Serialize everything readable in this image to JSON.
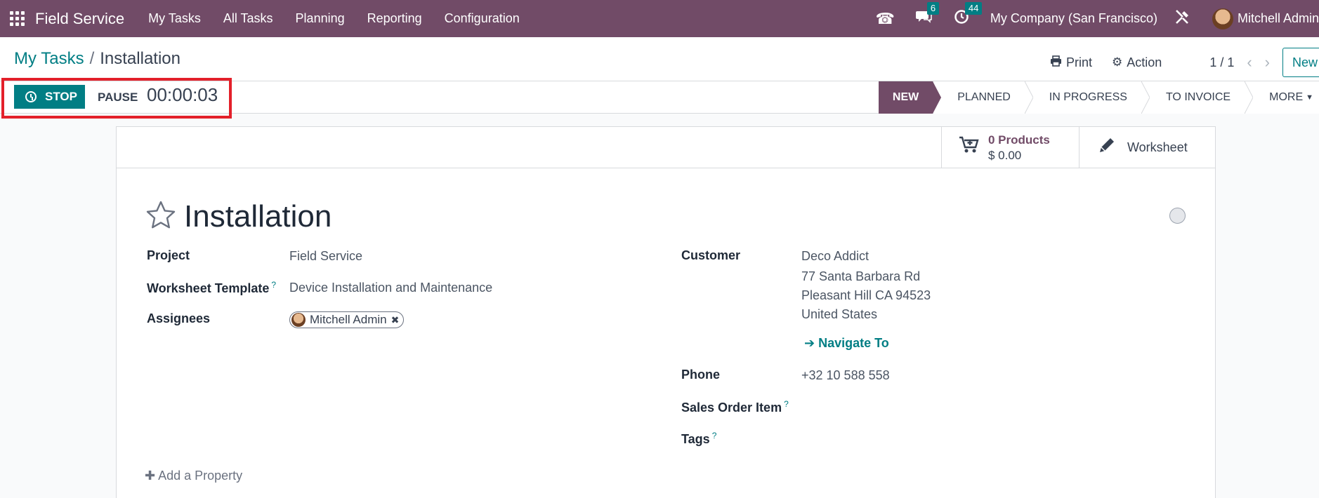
{
  "navbar": {
    "app_name": "Field Service",
    "menu": [
      "My Tasks",
      "All Tasks",
      "Planning",
      "Reporting",
      "Configuration"
    ],
    "messages_count": "6",
    "activities_count": "44",
    "company": "My Company (San Francisco)",
    "user": "Mitchell Admin"
  },
  "control_panel": {
    "breadcrumb_parent": "My Tasks",
    "breadcrumb_sep": "/",
    "breadcrumb_current": "Installation",
    "print_label": "Print",
    "action_label": "Action",
    "pager": "1 / 1",
    "new_label": "New"
  },
  "timer": {
    "stop_label": "STOP",
    "pause_label": "PAUSE",
    "elapsed": "00:00:03"
  },
  "stages": [
    "NEW",
    "PLANNED",
    "IN PROGRESS",
    "TO INVOICE",
    "MORE"
  ],
  "active_stage": "NEW",
  "button_box": {
    "products_title": "0 Products",
    "products_value": "$ 0.00",
    "worksheet_label": "Worksheet"
  },
  "record": {
    "title": "Installation",
    "project_label": "Project",
    "project_value": "Field Service",
    "worksheet_template_label": "Worksheet Template",
    "worksheet_template_value": "Device Installation and Maintenance",
    "assignees_label": "Assignees",
    "assignee": "Mitchell Admin",
    "customer_label": "Customer",
    "customer_name": "Deco Addict",
    "customer_street": "77 Santa Barbara Rd",
    "customer_city": "Pleasant Hill CA 94523",
    "customer_country": "United States",
    "navigate_label": "Navigate To",
    "phone_label": "Phone",
    "phone_value": "+32 10 588 558",
    "sales_order_item_label": "Sales Order Item",
    "tags_label": "Tags",
    "help_mark": "?",
    "add_property_label": "Add a Property"
  },
  "colors": {
    "brand": "#714b67",
    "accent": "#017e84",
    "highlight": "#e3202a"
  }
}
